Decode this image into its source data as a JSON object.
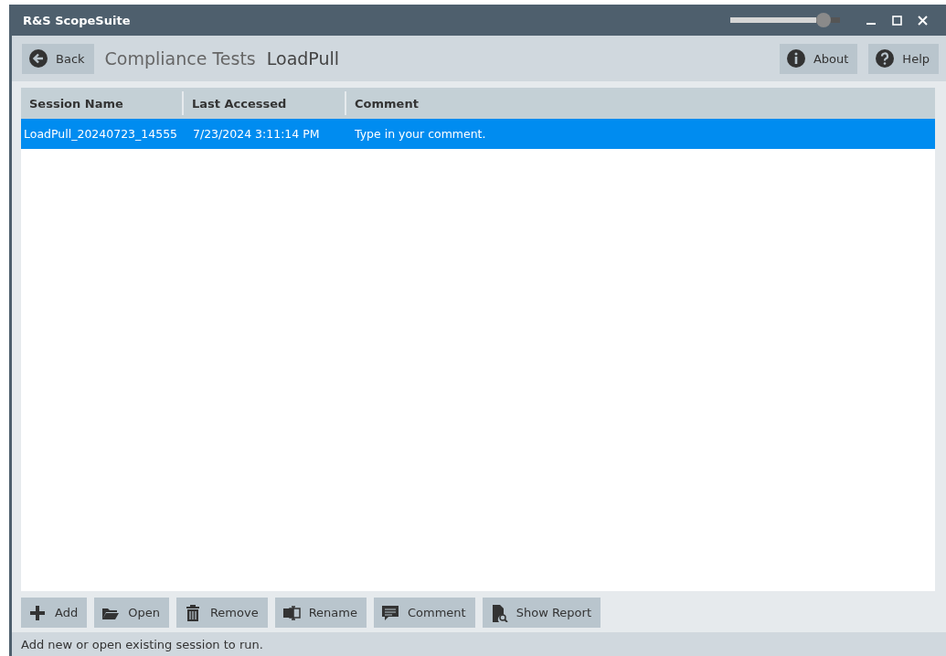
{
  "window": {
    "title": "R&S ScopeSuite",
    "zoom_slider": {
      "level": 0.9
    }
  },
  "toolbar": {
    "back": "Back",
    "breadcrumb": [
      {
        "label": "Compliance Tests",
        "current": false
      },
      {
        "label": "LoadPull",
        "current": true
      }
    ],
    "buttons": [
      {
        "kind": "about",
        "label": "About"
      },
      {
        "kind": "help",
        "label": "Help"
      }
    ]
  },
  "table": {
    "columns": [
      "Session Name",
      "Last Accessed",
      "Comment"
    ],
    "rows": [
      {
        "cells": [
          "LoadPull_20240723_14555",
          "7/23/2024 3:11:14 PM",
          "Type in your comment."
        ],
        "selected": true
      }
    ]
  },
  "actions": [
    {
      "kind": "add",
      "label": "Add"
    },
    {
      "kind": "open",
      "label": "Open"
    },
    {
      "kind": "remove",
      "label": "Remove"
    },
    {
      "kind": "rename",
      "label": "Rename"
    },
    {
      "kind": "comment",
      "label": "Comment"
    },
    {
      "kind": "report",
      "label": "Show Report"
    }
  ],
  "status_bar": "Add new or open existing session to run."
}
